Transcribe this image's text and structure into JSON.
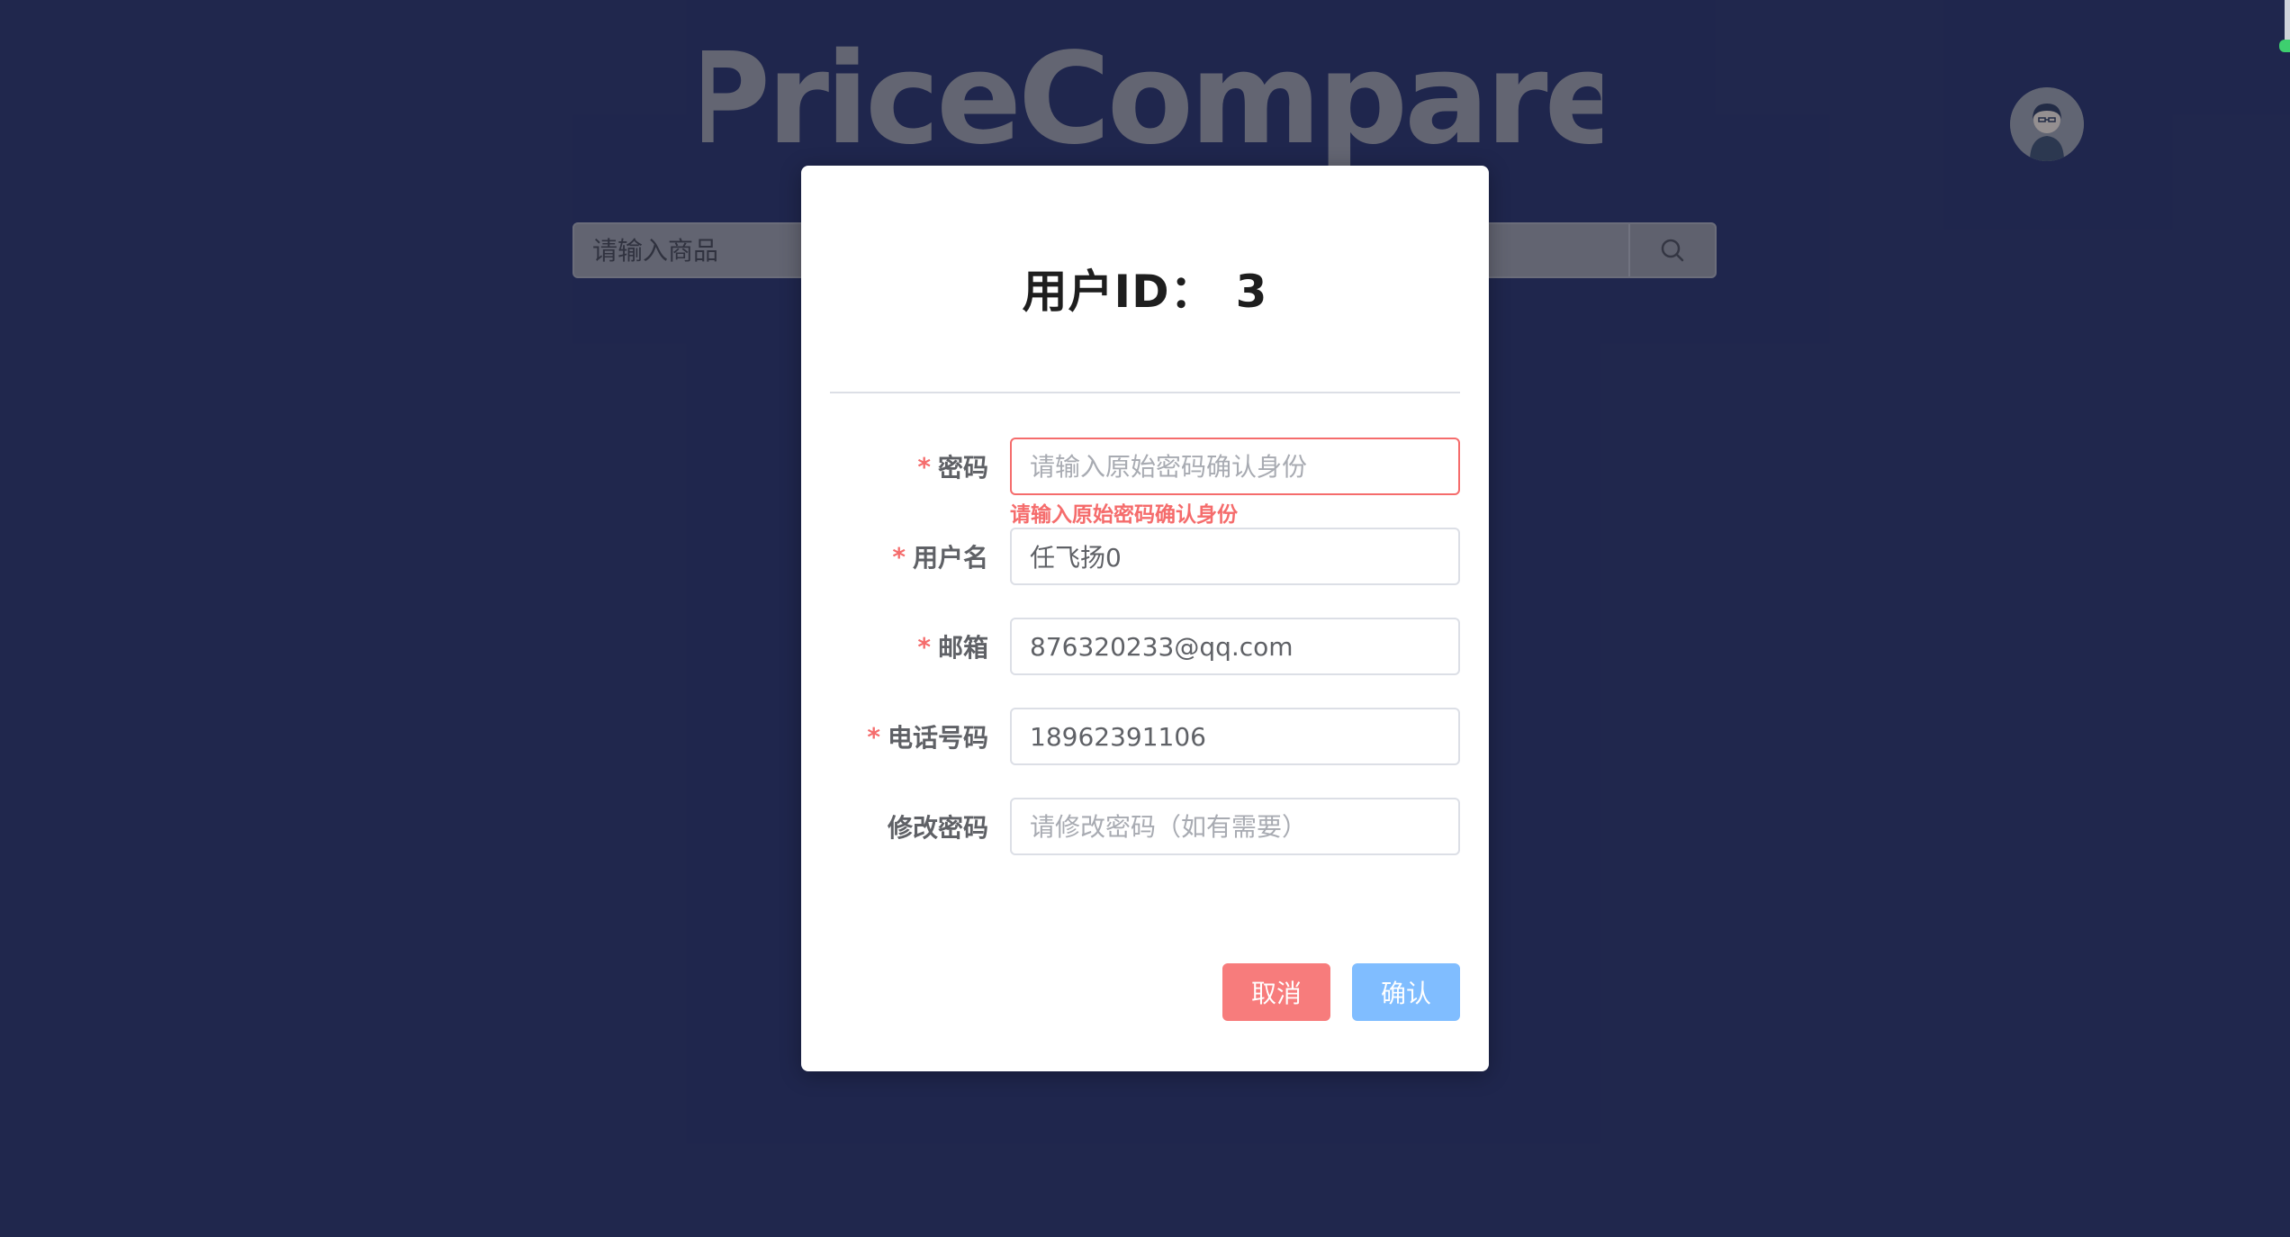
{
  "header": {
    "logo_text": "PriceCompare",
    "avatar_alt": "user-avatar"
  },
  "search": {
    "placeholder": "请输入商品",
    "icon": "search-icon"
  },
  "dialog": {
    "title_prefix": "用户ID：",
    "user_id": "3",
    "fields": {
      "password": {
        "label": "密码",
        "required": true,
        "value": "",
        "placeholder": "请输入原始密码确认身份",
        "error": "请输入原始密码确认身份"
      },
      "username": {
        "label": "用户名",
        "required": true,
        "value": "任飞扬0",
        "placeholder": ""
      },
      "email": {
        "label": "邮箱",
        "required": true,
        "value": "876320233@qq.com",
        "placeholder": ""
      },
      "phone": {
        "label": "电话号码",
        "required": true,
        "value": "18962391106",
        "placeholder": ""
      },
      "new_password": {
        "label": "修改密码",
        "required": false,
        "value": "",
        "placeholder": "请修改密码（如有需要）"
      }
    },
    "required_mark": "*",
    "buttons": {
      "cancel": "取消",
      "confirm": "确认"
    }
  },
  "colors": {
    "background": "#262f5c",
    "error": "#f56c6c",
    "cancel": "#f77c7c",
    "confirm": "#80bdff"
  }
}
